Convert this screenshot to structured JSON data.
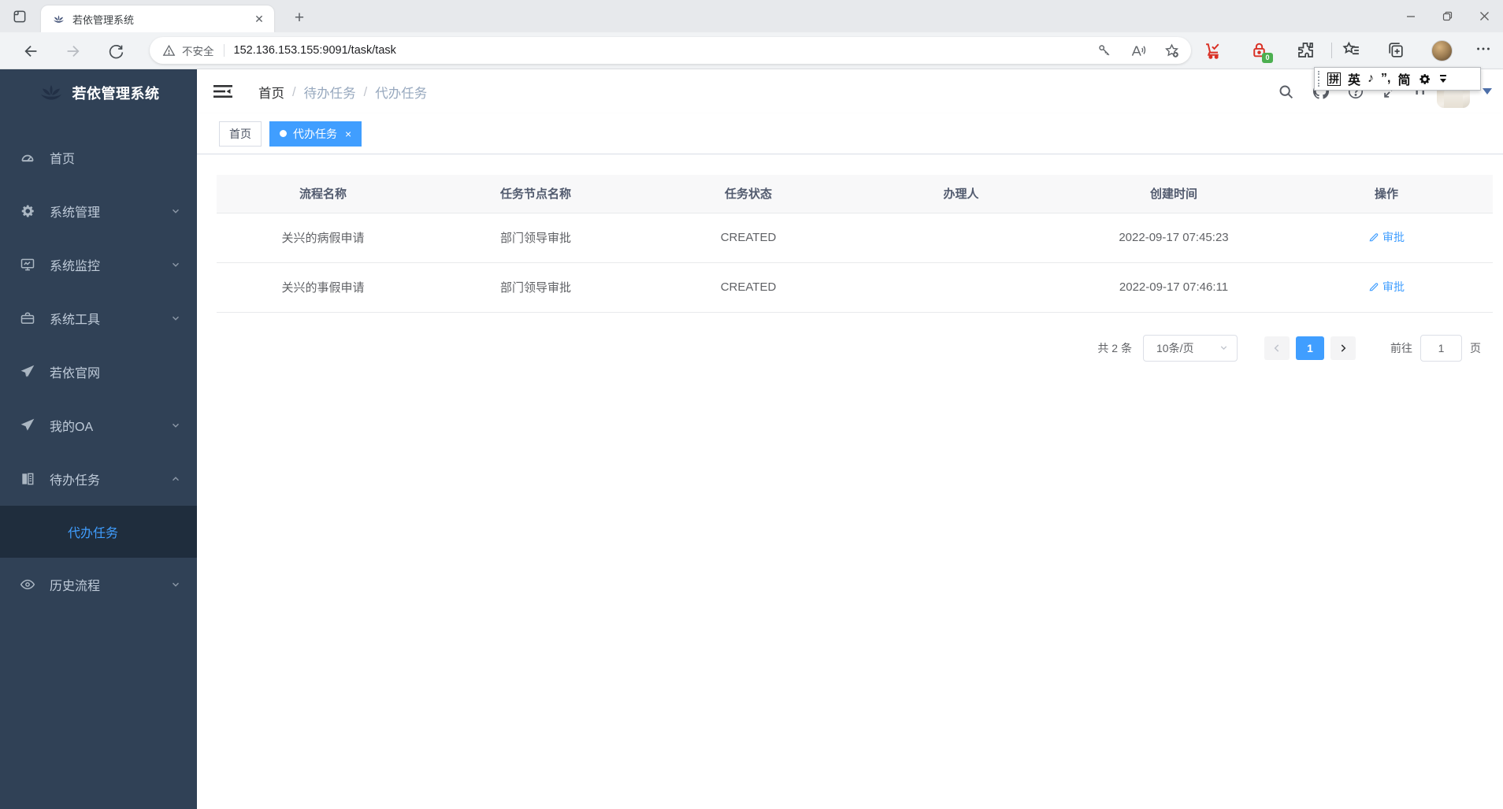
{
  "browser": {
    "tab": {
      "title": "若依管理系统"
    },
    "address": {
      "security_label": "不安全",
      "url": "152.136.153.155:9091/task/task"
    },
    "extensions": {
      "lock_badge": "0"
    }
  },
  "ime_bar": {
    "pinyin": "拼",
    "english": "英",
    "sound": "♪",
    "punct": "”,",
    "simplified": "简"
  },
  "app": {
    "sidebar": {
      "logo_title": "若依管理系统",
      "items": [
        {
          "label": "首页"
        },
        {
          "label": "系统管理"
        },
        {
          "label": "系统监控"
        },
        {
          "label": "系统工具"
        },
        {
          "label": "若依官网"
        },
        {
          "label": "我的OA"
        },
        {
          "label": "待办任务"
        },
        {
          "label": "历史流程"
        }
      ],
      "submenu": {
        "label": "代办任务"
      }
    },
    "breadcrumb": {
      "items": [
        "首页",
        "待办任务",
        "代办任务"
      ],
      "separator": "/"
    },
    "tags": {
      "home": "首页",
      "current": "代办任务"
    },
    "table": {
      "columns": [
        "流程名称",
        "任务节点名称",
        "任务状态",
        "办理人",
        "创建时间",
        "操作"
      ],
      "action_label": "审批",
      "rows": [
        {
          "process_name": "关兴的病假申请",
          "task_node": "部门领导审批",
          "status": "CREATED",
          "assignee": "",
          "created_at": "2022-09-17 07:45:23",
          "action": "审批"
        },
        {
          "process_name": "关兴的事假申请",
          "task_node": "部门领导审批",
          "status": "CREATED",
          "assignee": "",
          "created_at": "2022-09-17 07:46:11",
          "action": "审批"
        }
      ]
    },
    "pagination": {
      "total": "共 2 条",
      "page_size": "10条/页",
      "page": "1",
      "goto_label": "前往",
      "goto_value": "1",
      "unit_label": "页"
    },
    "colors": {
      "primary": "#409EFF",
      "sidebar_bg": "#304156",
      "submenu_bg": "#1f2d3d"
    }
  }
}
